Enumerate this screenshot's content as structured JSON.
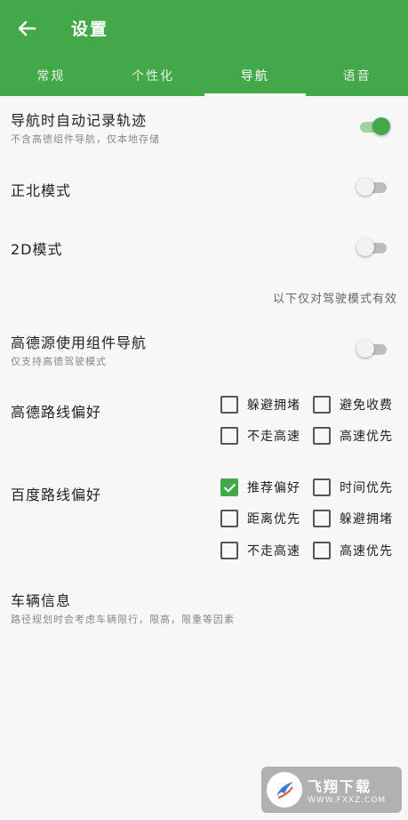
{
  "header": {
    "title": "设置",
    "tabs": [
      "常规",
      "个性化",
      "导航",
      "语音"
    ],
    "active_tab": 2
  },
  "settings": {
    "auto_track": {
      "title": "导航时自动记录轨迹",
      "subtitle": "不含高德组件导航，仅本地存储",
      "on": true
    },
    "north_mode": {
      "title": "正北模式",
      "on": false
    },
    "mode_2d": {
      "title": "2D模式",
      "on": false
    },
    "drive_note": "以下仅对驾驶模式有效",
    "amap_component": {
      "title": "高德源使用组件导航",
      "subtitle": "仅支持高德驾驶模式",
      "on": false
    },
    "amap_route": {
      "title": "高德路线偏好",
      "options": [
        {
          "label": "躲避拥堵",
          "checked": false
        },
        {
          "label": "避免收费",
          "checked": false
        },
        {
          "label": "不走高速",
          "checked": false
        },
        {
          "label": "高速优先",
          "checked": false
        }
      ]
    },
    "baidu_route": {
      "title": "百度路线偏好",
      "options": [
        {
          "label": "推荐偏好",
          "checked": true
        },
        {
          "label": "时间优先",
          "checked": false
        },
        {
          "label": "距离优先",
          "checked": false
        },
        {
          "label": "躲避拥堵",
          "checked": false
        },
        {
          "label": "不走高速",
          "checked": false
        },
        {
          "label": "高速优先",
          "checked": false
        }
      ]
    },
    "vehicle_info": {
      "title": "车辆信息",
      "subtitle": "路径规划时会考虑车辆限行，限高，限重等因素"
    }
  },
  "watermark": {
    "brand": "飞翔下载",
    "url": "WWW.FXXZ.COM"
  },
  "colors": {
    "primary": "#43a84a",
    "background": "#f7f7f7"
  }
}
